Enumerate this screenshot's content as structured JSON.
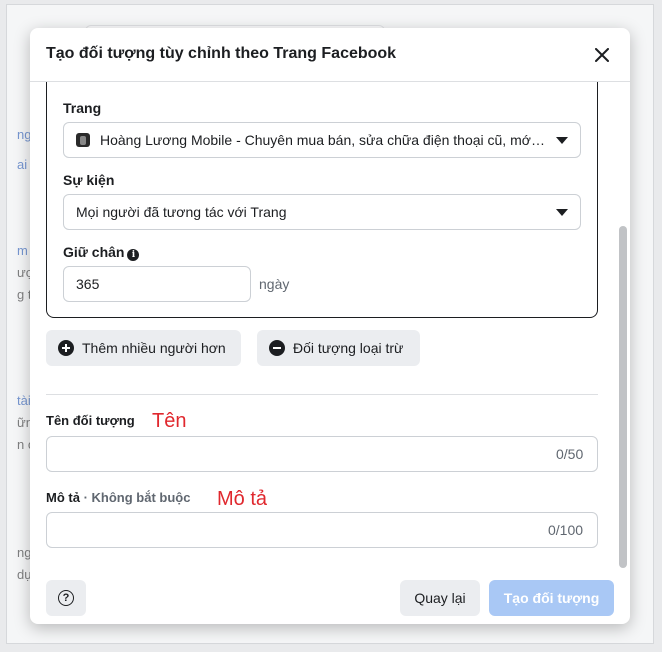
{
  "background": {
    "fragments": [
      {
        "text": "ng t",
        "link": true
      },
      {
        "text": "ai kh",
        "link": true
      },
      {
        "text": "m t",
        "link": true
      },
      {
        "text": "ượn",
        "link": false
      },
      {
        "text": "g tru",
        "link": false
      },
      {
        "text": "tài",
        "link": true
      },
      {
        "text": "ững",
        "link": false
      },
      {
        "text": "n c",
        "link": false
      },
      {
        "text": "ng",
        "link": false
      },
      {
        "text": "dụ",
        "link": false
      }
    ]
  },
  "modal": {
    "title": "Tạo đối tượng tùy chỉnh theo Trang Facebook",
    "page_label": "Trang",
    "page_value": "Hoàng Lương Mobile - Chuyên mua bán, sửa chữa điện thoại cũ, mới ...",
    "event_label": "Sự kiện",
    "event_value": "Mọi người đã tương tác với Trang",
    "retention_label": "Giữ chân",
    "retention_value": "365",
    "retention_unit": "ngày",
    "add_more_button": "Thêm nhiều người hơn",
    "exclude_button": "Đối tượng loại trừ",
    "name_label": "Tên đối tượng",
    "name_annotation": "Tên",
    "name_counter": "0/50",
    "description_label": "Mô tả",
    "description_optional": " · Không bắt buộc",
    "description_annotation": "Mô tả",
    "description_counter": "0/100",
    "back_button": "Quay lại",
    "create_button": "Tạo đối tượng"
  },
  "colors": {
    "primary_disabled": "#a9c8f5",
    "annotation_red": "#e0282e",
    "text": "#1c1e21"
  },
  "icons": {
    "close": "close-icon",
    "info": "info-icon",
    "plus": "plus-circle-icon",
    "minus": "minus-circle-icon",
    "help": "help-icon",
    "dropdown": "caret-down-icon"
  }
}
